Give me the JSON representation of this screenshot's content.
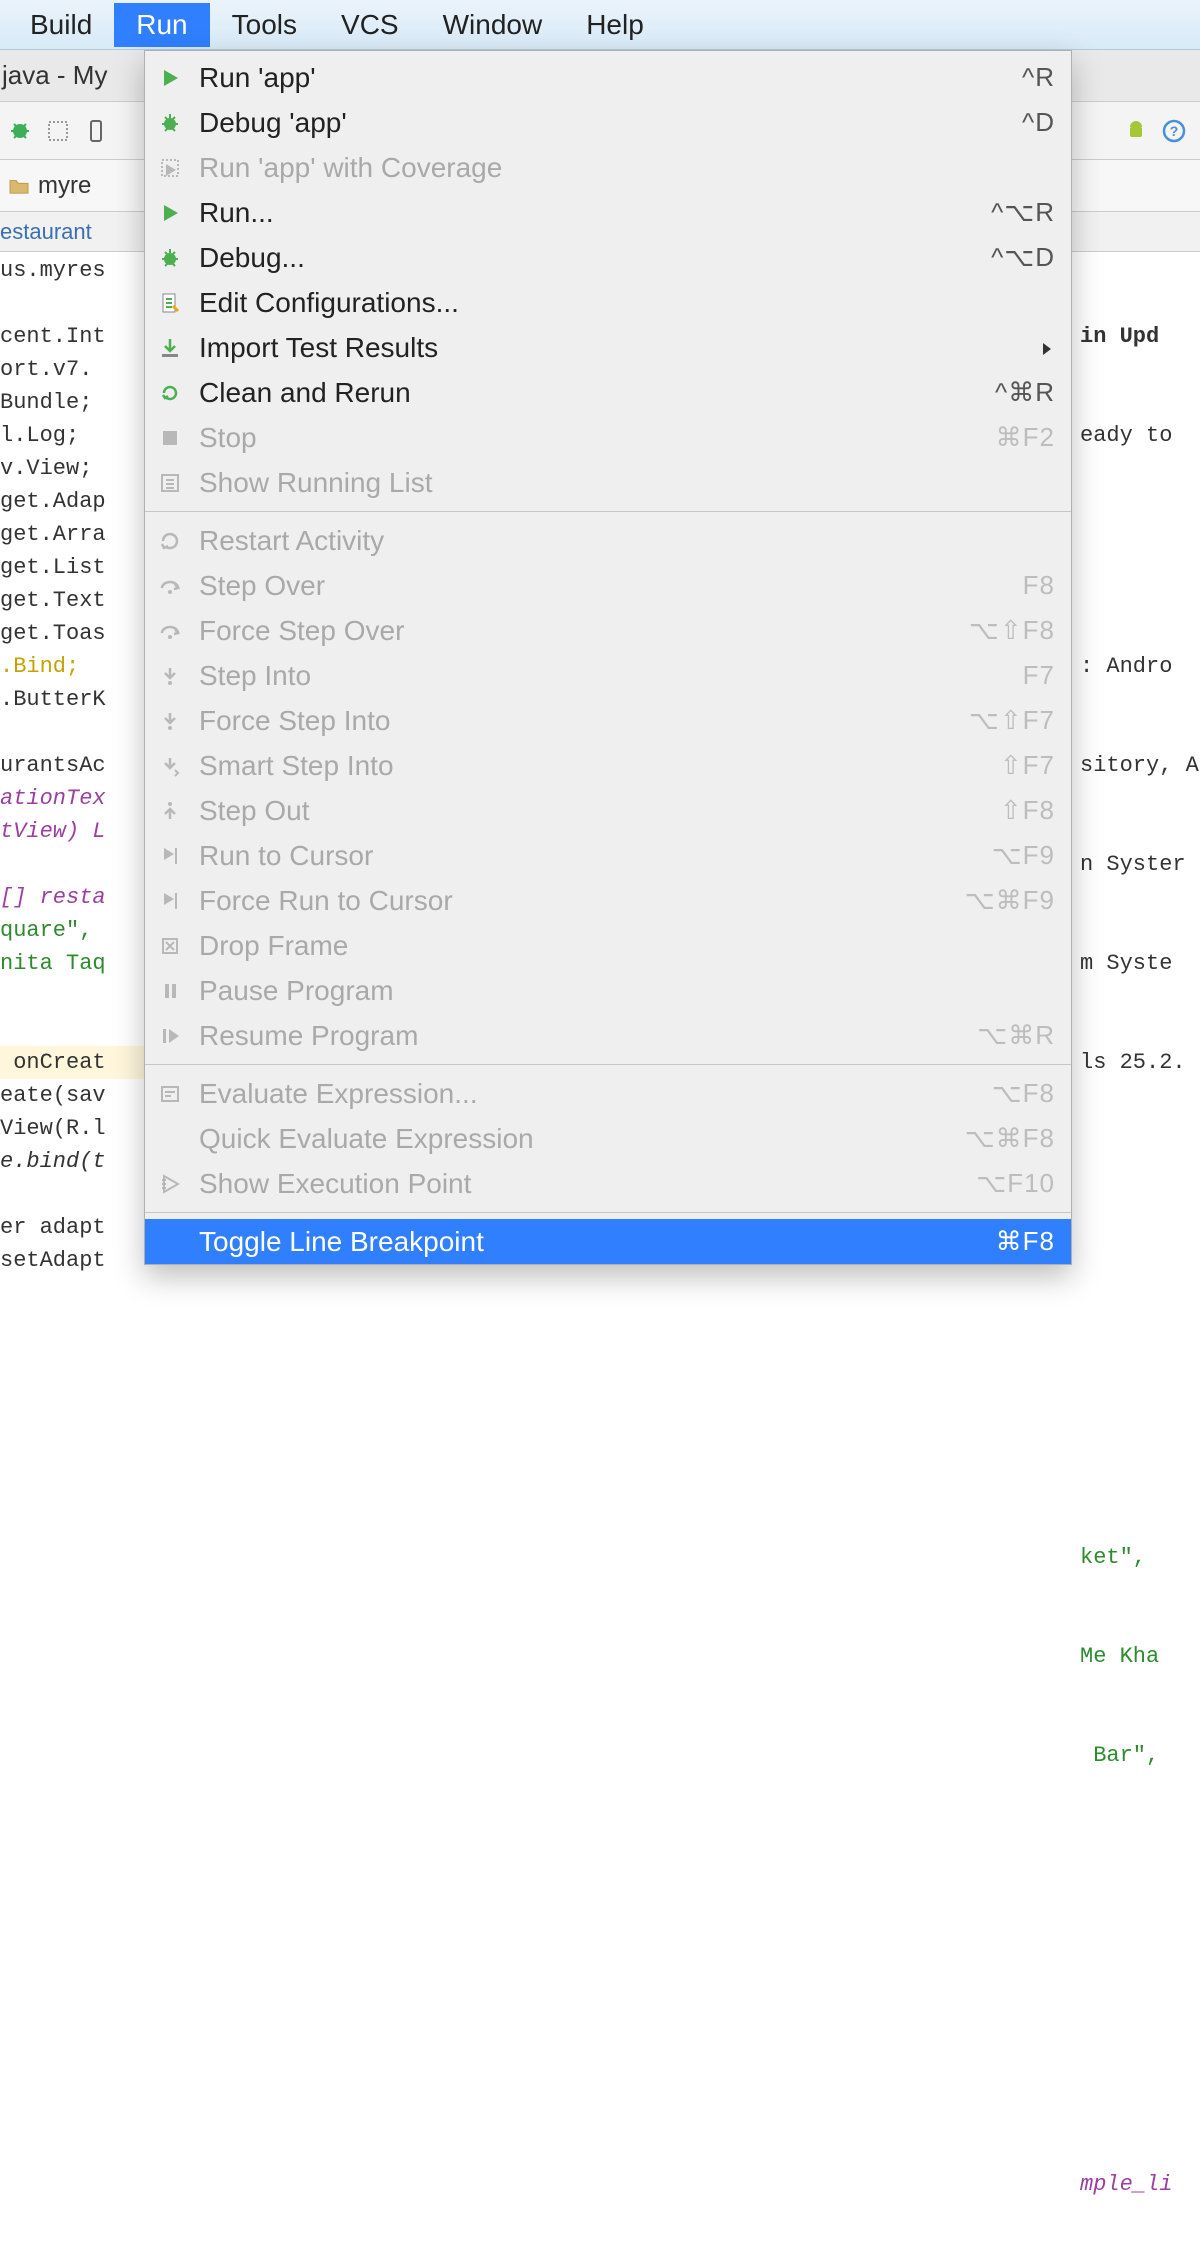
{
  "menubar": {
    "items": [
      "Build",
      "Run",
      "Tools",
      "VCS",
      "Window",
      "Help"
    ],
    "active_index": 1
  },
  "titlebar": {
    "text": "java - My"
  },
  "crumbbar": {
    "text": "myre"
  },
  "tabstrip": {
    "text": "estaurant"
  },
  "code_left": [
    {
      "t": "us.myres"
    },
    {
      "t": ""
    },
    {
      "t": "cent.Int"
    },
    {
      "t": "ort.v7."
    },
    {
      "t": "Bundle;"
    },
    {
      "t": "l.Log;"
    },
    {
      "t": "v.View;"
    },
    {
      "t": "get.Adap"
    },
    {
      "t": "get.Arra"
    },
    {
      "t": "get.List"
    },
    {
      "t": "get.Text"
    },
    {
      "t": "get.Toas"
    },
    {
      "t": ".Bind;",
      "cls": "ann"
    },
    {
      "t": ".ButterK"
    },
    {
      "t": ""
    },
    {
      "t": "urantsAc"
    },
    {
      "t": "ationTex",
      "cls": "kw"
    },
    {
      "t": "tView) L",
      "cls": "kw"
    },
    {
      "t": ""
    },
    {
      "t": "[] resta",
      "cls": "kw"
    },
    {
      "t": "quare\", ",
      "cls": "str"
    },
    {
      "t": "nita Taq",
      "cls": "str"
    },
    {
      "t": ""
    },
    {
      "t": ""
    },
    {
      "t": " onCreat",
      "hl": true
    },
    {
      "t": "eate(sav"
    },
    {
      "t": "View(R.l"
    },
    {
      "t": "e.bind(t",
      "it": true
    },
    {
      "t": ""
    },
    {
      "t": "er adapt"
    },
    {
      "t": "setAdapt"
    }
  ],
  "code_right_upd": "in Upd",
  "code_right_ready": "eady to",
  "code_right_lines": [
    ": Andro",
    "sitory, A",
    "n Syster",
    "m Syste",
    "ls 25.2."
  ],
  "code_right_strings": [
    "ket\", ",
    "Me Kha",
    " Bar\",  "
  ],
  "code_right_sample": "mple_li",
  "dropdown": {
    "sections": [
      [
        {
          "icon": "run",
          "label": "Run 'app'",
          "shortcut": "^R"
        },
        {
          "icon": "bug",
          "label": "Debug 'app'",
          "shortcut": "^D"
        },
        {
          "icon": "coverage",
          "label": "Run 'app' with Coverage",
          "disabled": true
        },
        {
          "icon": "run",
          "label": "Run...",
          "shortcut": "^⌥R"
        },
        {
          "icon": "bug",
          "label": "Debug...",
          "shortcut": "^⌥D"
        },
        {
          "icon": "edit",
          "label": "Edit Configurations..."
        },
        {
          "icon": "import",
          "label": "Import Test Results",
          "submenu": true
        },
        {
          "icon": "rerun",
          "label": "Clean and Rerun",
          "shortcut": "^⌘R"
        },
        {
          "icon": "stop",
          "label": "Stop",
          "shortcut": "⌘F2",
          "disabled": true
        },
        {
          "icon": "list",
          "label": "Show Running List",
          "disabled": true
        }
      ],
      [
        {
          "icon": "restart",
          "label": "Restart Activity",
          "disabled": true
        },
        {
          "icon": "stepover",
          "label": "Step Over",
          "shortcut": "F8",
          "disabled": true
        },
        {
          "icon": "fstepover",
          "label": "Force Step Over",
          "shortcut": "⌥⇧F8",
          "disabled": true
        },
        {
          "icon": "stepinto",
          "label": "Step Into",
          "shortcut": "F7",
          "disabled": true
        },
        {
          "icon": "fstepinto",
          "label": "Force Step Into",
          "shortcut": "⌥⇧F7",
          "disabled": true
        },
        {
          "icon": "smartstep",
          "label": "Smart Step Into",
          "shortcut": "⇧F7",
          "disabled": true
        },
        {
          "icon": "stepout",
          "label": "Step Out",
          "shortcut": "⇧F8",
          "disabled": true
        },
        {
          "icon": "runcursor",
          "label": "Run to Cursor",
          "shortcut": "⌥F9",
          "disabled": true
        },
        {
          "icon": "fruncursor",
          "label": "Force Run to Cursor",
          "shortcut": "⌥⌘F9",
          "disabled": true
        },
        {
          "icon": "dropframe",
          "label": "Drop Frame",
          "disabled": true
        },
        {
          "icon": "pause",
          "label": "Pause Program",
          "disabled": true
        },
        {
          "icon": "resume",
          "label": "Resume Program",
          "shortcut": "⌥⌘R",
          "disabled": true
        }
      ],
      [
        {
          "icon": "eval",
          "label": "Evaluate Expression...",
          "shortcut": "⌥F8",
          "disabled": true
        },
        {
          "icon": "",
          "label": "Quick Evaluate Expression",
          "shortcut": "⌥⌘F8",
          "disabled": true
        },
        {
          "icon": "showexec",
          "label": "Show Execution Point",
          "shortcut": "⌥F10",
          "disabled": true
        }
      ],
      [
        {
          "icon": "",
          "label": "Toggle Line Breakpoint",
          "shortcut": "⌘F8",
          "selected": true
        }
      ]
    ]
  }
}
